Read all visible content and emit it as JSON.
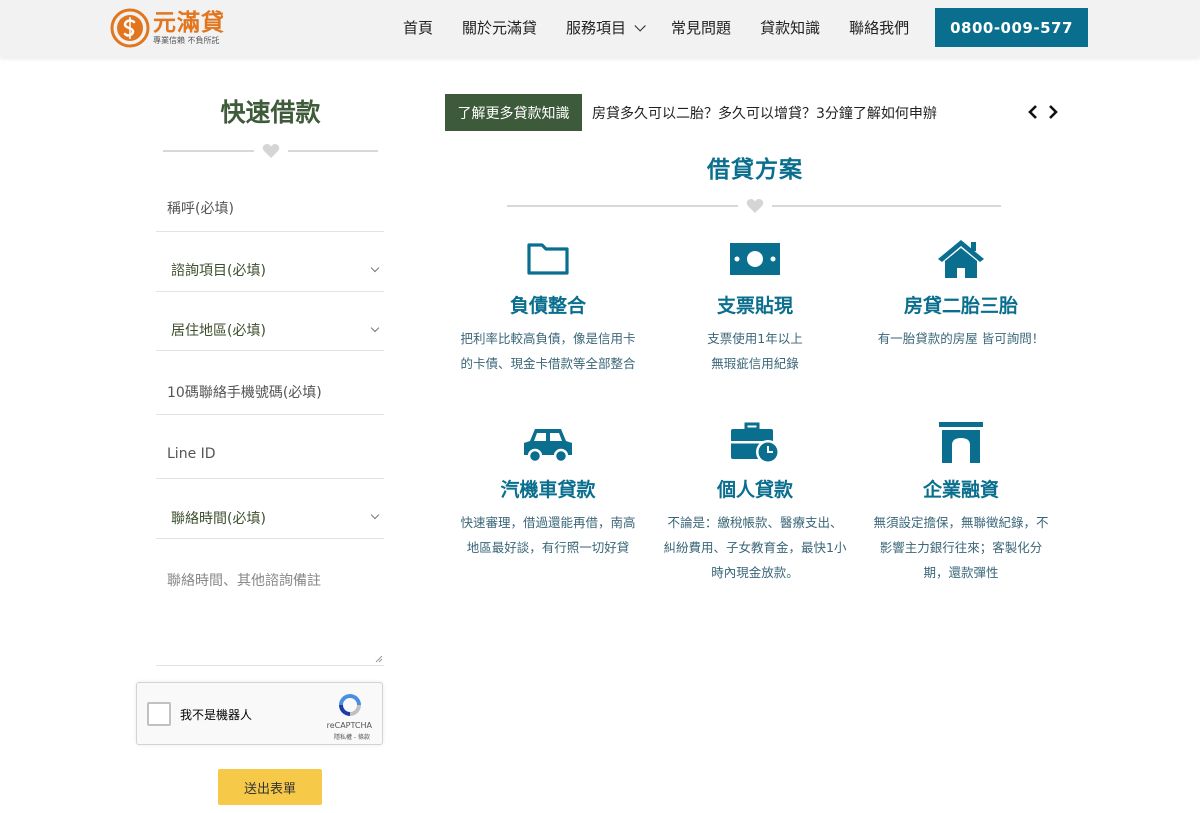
{
  "header": {
    "logo_name": "元滿貸",
    "logo_slogan": "專業信賴 不負所託",
    "nav": [
      "首頁",
      "關於元滿貸",
      "服務項目",
      "常見問題",
      "貸款知識",
      "聯絡我們"
    ],
    "phone": "0800-009-577"
  },
  "form": {
    "title": "快速借款",
    "fields": {
      "name_placeholder": "稱呼(必填)",
      "consult_item": "諮詢項目(必填)",
      "region": "居住地區(必填)",
      "phone_placeholder": "10碼聯絡手機號碼(必填)",
      "line_placeholder": "Line ID",
      "contact_time": "聯絡時間(必填)",
      "notes_placeholder": "聯絡時間、其他諮詢備註"
    },
    "recaptcha": {
      "label": "我不是機器人",
      "brand": "reCAPTCHA",
      "terms": "隱私權 - 條款"
    },
    "submit": "送出表單"
  },
  "news": {
    "tag": "了解更多貸款知識",
    "title": "房貸多久可以二胎？多久可以增貸？3分鐘了解如何申辦"
  },
  "plans": {
    "title": "借貸方案",
    "items": [
      {
        "icon": "folder-icon",
        "title": "負債整合",
        "desc": [
          "把利率比較高負債，像是信用卡",
          "的卡債、現金卡借款等全部整合"
        ]
      },
      {
        "icon": "money-bill-icon",
        "title": "支票貼現",
        "desc": [
          "支票使用1年以上",
          "無瑕疵信用紀錄"
        ]
      },
      {
        "icon": "house-icon",
        "title": "房貸二胎三胎",
        "desc": [
          "有一胎貸款的房屋 皆可詢問！"
        ]
      },
      {
        "icon": "car-icon",
        "title": "汽機車貸款",
        "desc": [
          "快速審理，借過還能再借，南高",
          "地區最好談，有行照一切好貸"
        ]
      },
      {
        "icon": "briefcase-clock-icon",
        "title": "個人貸款",
        "desc": [
          "不論是：繳稅帳款、醫療支出、",
          "糾紛費用、子女教育金，最快1小",
          "時內現金放款。"
        ]
      },
      {
        "icon": "archway-icon",
        "title": "企業融資",
        "desc": [
          "無須設定擔保，無聯徵紀錄，不",
          "影響主力銀行往來；客製化分",
          "期，還款彈性"
        ]
      }
    ]
  },
  "colors": {
    "brand_teal": "#0a6e8e",
    "brand_green": "#3d5a3a",
    "logo_orange": "#e1761f",
    "submit_yellow": "#f7c948"
  }
}
